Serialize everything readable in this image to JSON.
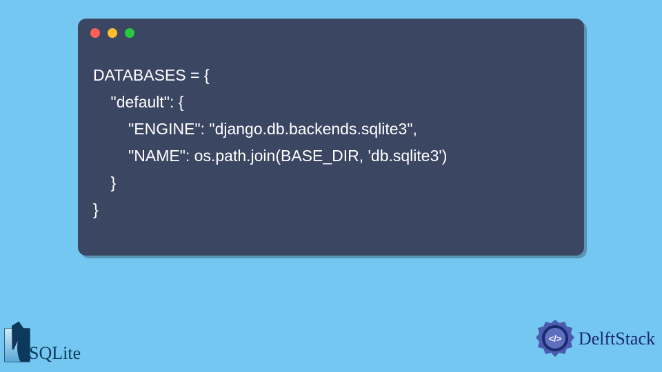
{
  "code": {
    "lines": [
      "DATABASES = {",
      "    \"default\": {",
      "        \"ENGINE\": \"django.db.backends.sqlite3\",",
      "        \"NAME\": os.path.join(BASE_DIR, 'db.sqlite3')",
      "    }",
      "}"
    ]
  },
  "branding": {
    "left_logo_text": "SQLite",
    "right_logo_text": "DelftStack",
    "right_logo_glyph": "</>"
  },
  "colors": {
    "page_bg": "#74c7f0",
    "panel_bg": "#3b4663",
    "code_fg": "#ffffff",
    "dot_red": "#ff5f56",
    "dot_yellow": "#ffbd2e",
    "dot_green": "#27c93f",
    "delft_primary": "#1a2a6c"
  }
}
